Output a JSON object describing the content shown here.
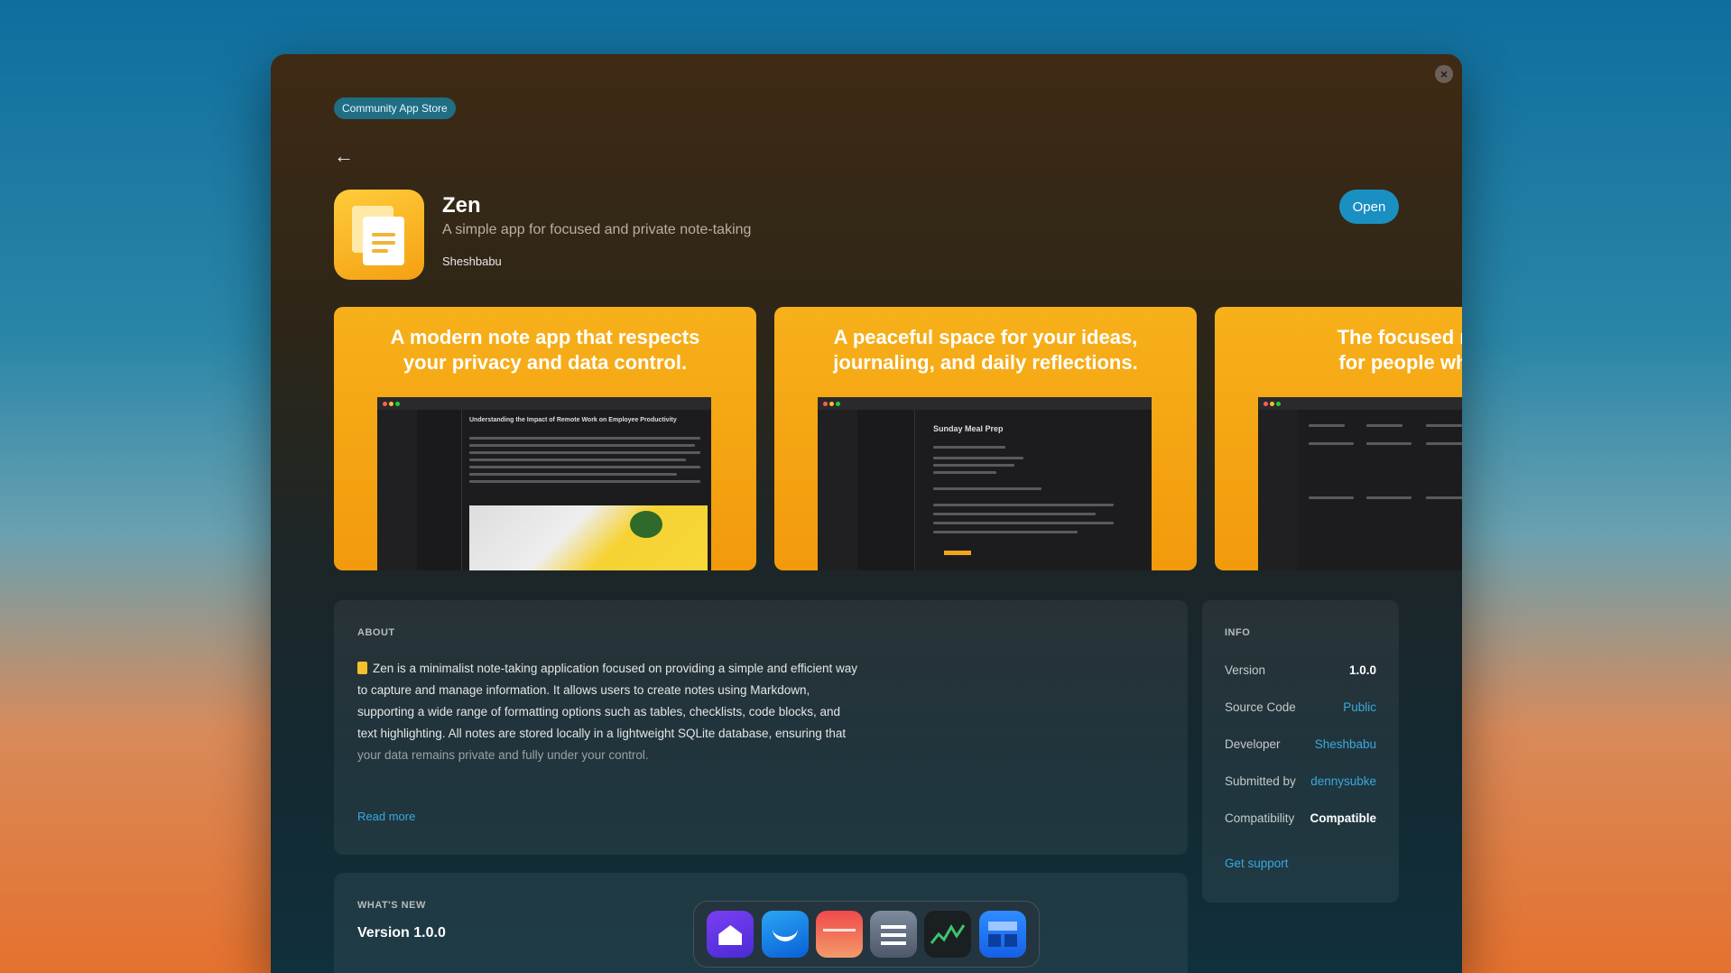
{
  "store_badge": "Community App Store",
  "app": {
    "name": "Zen",
    "subtitle": "A simple app for focused and private note-taking",
    "developer": "Sheshbabu",
    "open_label": "Open"
  },
  "screenshots": [
    {
      "caption_line1": "A modern note app that respects",
      "caption_line2": "your privacy and data control.",
      "note_title": "Understanding the Impact of Remote Work on Employee Productivity"
    },
    {
      "caption_line1": "A peaceful space for your ideas,",
      "caption_line2": "journaling, and daily reflections.",
      "note_title": "Sunday Meal Prep"
    },
    {
      "caption_line1": "The focused note-t",
      "caption_line2": "for people who val",
      "note_title": ""
    }
  ],
  "about": {
    "label": "ABOUT",
    "text": "Zen is a minimalist note-taking application focused on providing a simple and efficient way to capture and manage information. It allows users to create notes using Markdown, supporting a wide range of formatting options such as tables, checklists, code blocks, and text highlighting. All notes are stored locally in a lightweight SQLite database, ensuring that",
    "text_fade": "your data remains private and fully under your control.",
    "read_more": "Read more"
  },
  "info": {
    "label": "INFO",
    "rows": [
      {
        "key": "Version",
        "value": "1.0.0"
      },
      {
        "key": "Source Code",
        "value": "Public"
      },
      {
        "key": "Developer",
        "value": "Sheshbabu"
      },
      {
        "key": "Submitted by",
        "value": "dennysubke"
      },
      {
        "key": "Compatibility",
        "value": "Compatible"
      }
    ],
    "support": "Get support"
  },
  "whats_new": {
    "label": "WHAT'S NEW",
    "version": "Version 1.0.0"
  },
  "icons": {
    "close": "close-icon",
    "back": "arrow-left-icon",
    "app": "notes-icon"
  },
  "colors": {
    "accent": "#1a8fc1",
    "link": "#3aa8e0",
    "badge": "#1f6e84"
  }
}
